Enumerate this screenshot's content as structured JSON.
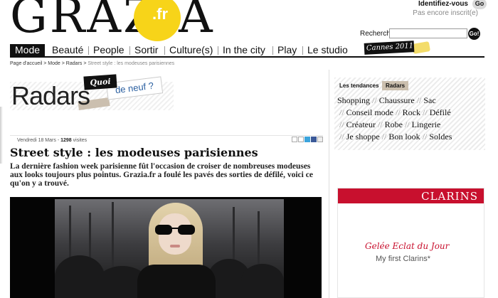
{
  "header": {
    "logo_text": "GRAZIA",
    "logo_suffix": ".fr",
    "login_label": "Identifiez-vous",
    "login_go": "Go",
    "register_label": "Pas encore inscrit(e)",
    "search_label": "Recherche",
    "search_value": "",
    "search_go": "Go!"
  },
  "nav": {
    "items": [
      "Mode",
      "Beauté",
      "People",
      "Sortir",
      "Culture(s)",
      "In the city",
      "Play",
      "Le studio"
    ],
    "active_index": 0,
    "cannes_label": "Cannes",
    "cannes_year": "2011"
  },
  "breadcrumb": {
    "items": [
      "Page d'accueil",
      "Mode",
      "Radars"
    ],
    "separator": " > ",
    "current": "Street style : les modeuses parisiennes"
  },
  "section": {
    "title": "Radars",
    "badge_quoi": "Quoi",
    "badge_deneuf": "de neuf ?"
  },
  "article": {
    "date": "Vendredi 18 Mars",
    "views_count": "1298",
    "views_label": "visites",
    "title": "Street style : les modeuses parisiennes",
    "lead": "La dernière fashion week parisienne fût l'occasion de croiser de nombreuses modeuses aux looks toujours plus pointus. Grazia.fr a foulé les pavés des sorties de défilé, voici ce qu'on y a trouvé."
  },
  "sidebar": {
    "label": "Les tendances",
    "tab": "Radars",
    "tags": [
      "Shopping",
      "Chaussure",
      "Sac",
      "Conseil mode",
      "Rock",
      "Défilé",
      "Créateur",
      "Robe",
      "Lingerie",
      "Je shoppe",
      "Bon look",
      "Soldes"
    ],
    "separator": "//"
  },
  "ad": {
    "brand": "CLARINS",
    "product": "Gelée Eclat du Jour",
    "slogan": "My first Clarins*"
  },
  "colors": {
    "accent_yellow": "#f7d419",
    "clarins_red": "#c8102e",
    "tape_beige": "#cbbfae",
    "link_blue": "#2a5fa0"
  }
}
